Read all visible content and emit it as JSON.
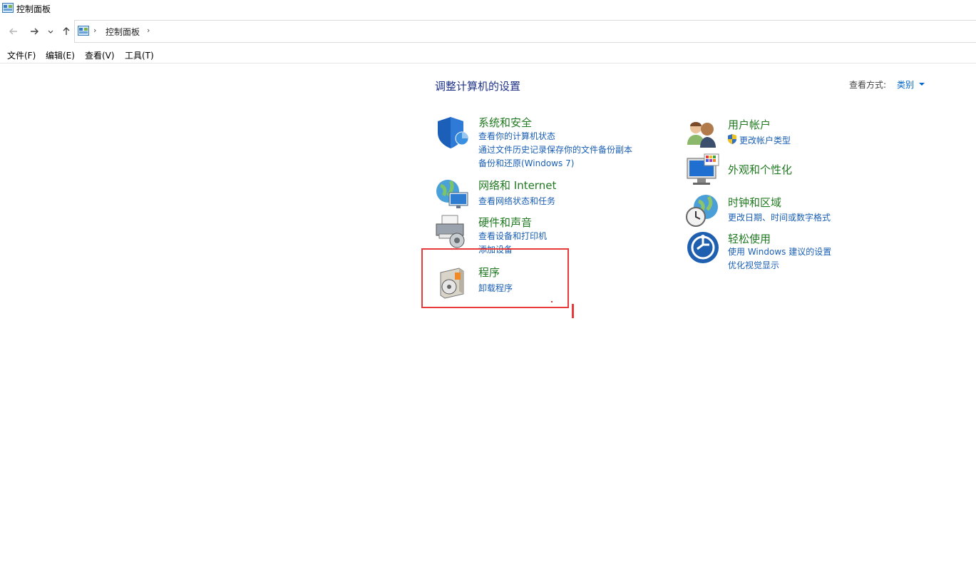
{
  "window": {
    "title": "控制面板"
  },
  "nav": {
    "breadcrumb": "控制面板",
    "separator": "›"
  },
  "menu": [
    "文件(F)",
    "编辑(E)",
    "查看(V)",
    "工具(T)"
  ],
  "heading": "调整计算机的设置",
  "view_by": {
    "label": "查看方式:",
    "value": "类别"
  },
  "categories_left": [
    {
      "title": "系统和安全",
      "icon": "shield-icon",
      "links": [
        "查看你的计算机状态",
        "通过文件历史记录保存你的文件备份副本",
        "备份和还原(Windows 7)"
      ]
    },
    {
      "title": "网络和 Internet",
      "icon": "network-globe-icon",
      "links": [
        "查看网络状态和任务"
      ]
    },
    {
      "title": "硬件和声音",
      "icon": "printer-speaker-icon",
      "links": [
        "查看设备和打印机",
        "添加设备"
      ]
    },
    {
      "title": "程序",
      "icon": "programs-disc-icon",
      "links": [
        "卸载程序"
      ]
    }
  ],
  "categories_right": [
    {
      "title": "用户帐户",
      "icon": "users-icon",
      "links": [
        "更改帐户类型"
      ]
    },
    {
      "title": "外观和个性化",
      "icon": "monitor-palette-icon",
      "links": []
    },
    {
      "title": "时钟和区域",
      "icon": "clock-globe-icon",
      "links": [
        "更改日期、时间或数字格式"
      ]
    },
    {
      "title": "轻松使用",
      "icon": "ease-of-access-icon",
      "links": [
        "使用 Windows 建议的设置",
        "优化视觉显示"
      ]
    }
  ],
  "colors": {
    "category_title": "#217a21",
    "link": "#1a5fb4",
    "heading": "#1e3287",
    "highlight": "#e83a3a"
  }
}
